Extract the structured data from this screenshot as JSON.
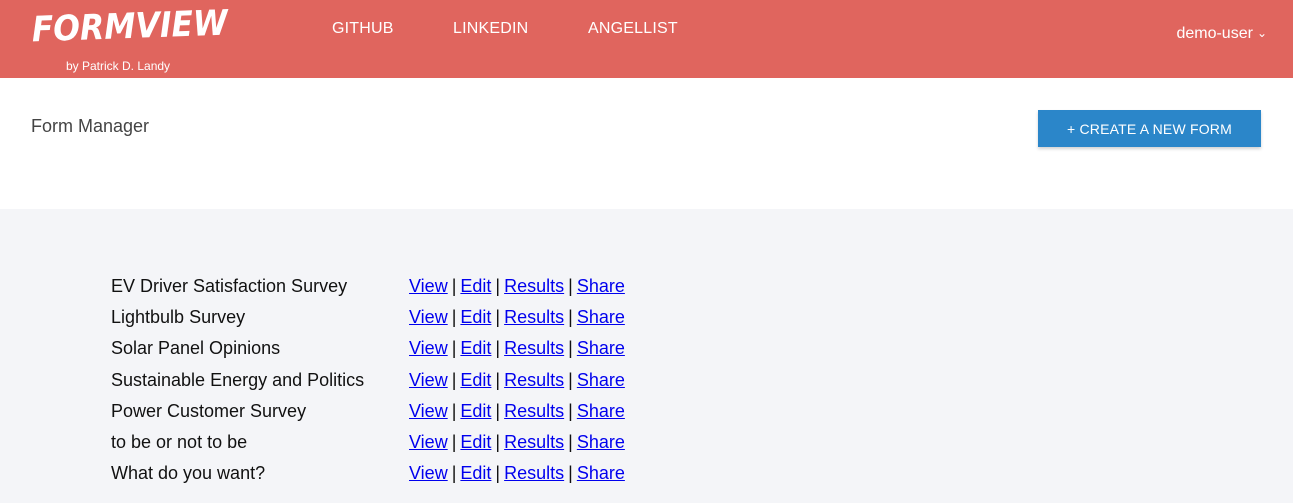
{
  "app": {
    "logo_text": "FORMVIEW",
    "byline": "by Patrick D. Landy"
  },
  "nav": {
    "github": "GITHUB",
    "linkedin": "LINKEDIN",
    "angellist": "ANGELLIST"
  },
  "user": {
    "name": "demo-user",
    "caret_icon": "chevron-down-icon"
  },
  "page": {
    "title": "Form Manager",
    "create_label": "+ CREATE A NEW FORM"
  },
  "colors": {
    "header": "#e0655e",
    "primary_button": "#2b86c9",
    "page_background": "#f4f5f8",
    "link": "#0000ee"
  },
  "actions": {
    "view": "View",
    "edit": "Edit",
    "results": "Results",
    "share": "Share",
    "separator": "|"
  },
  "forms": [
    {
      "name": "EV Driver Satisfaction Survey"
    },
    {
      "name": "Lightbulb Survey"
    },
    {
      "name": "Solar Panel Opinions"
    },
    {
      "name": "Sustainable Energy and Politics"
    },
    {
      "name": "Power Customer Survey"
    },
    {
      "name": "to be or not to be"
    },
    {
      "name": "What do you want?"
    }
  ]
}
